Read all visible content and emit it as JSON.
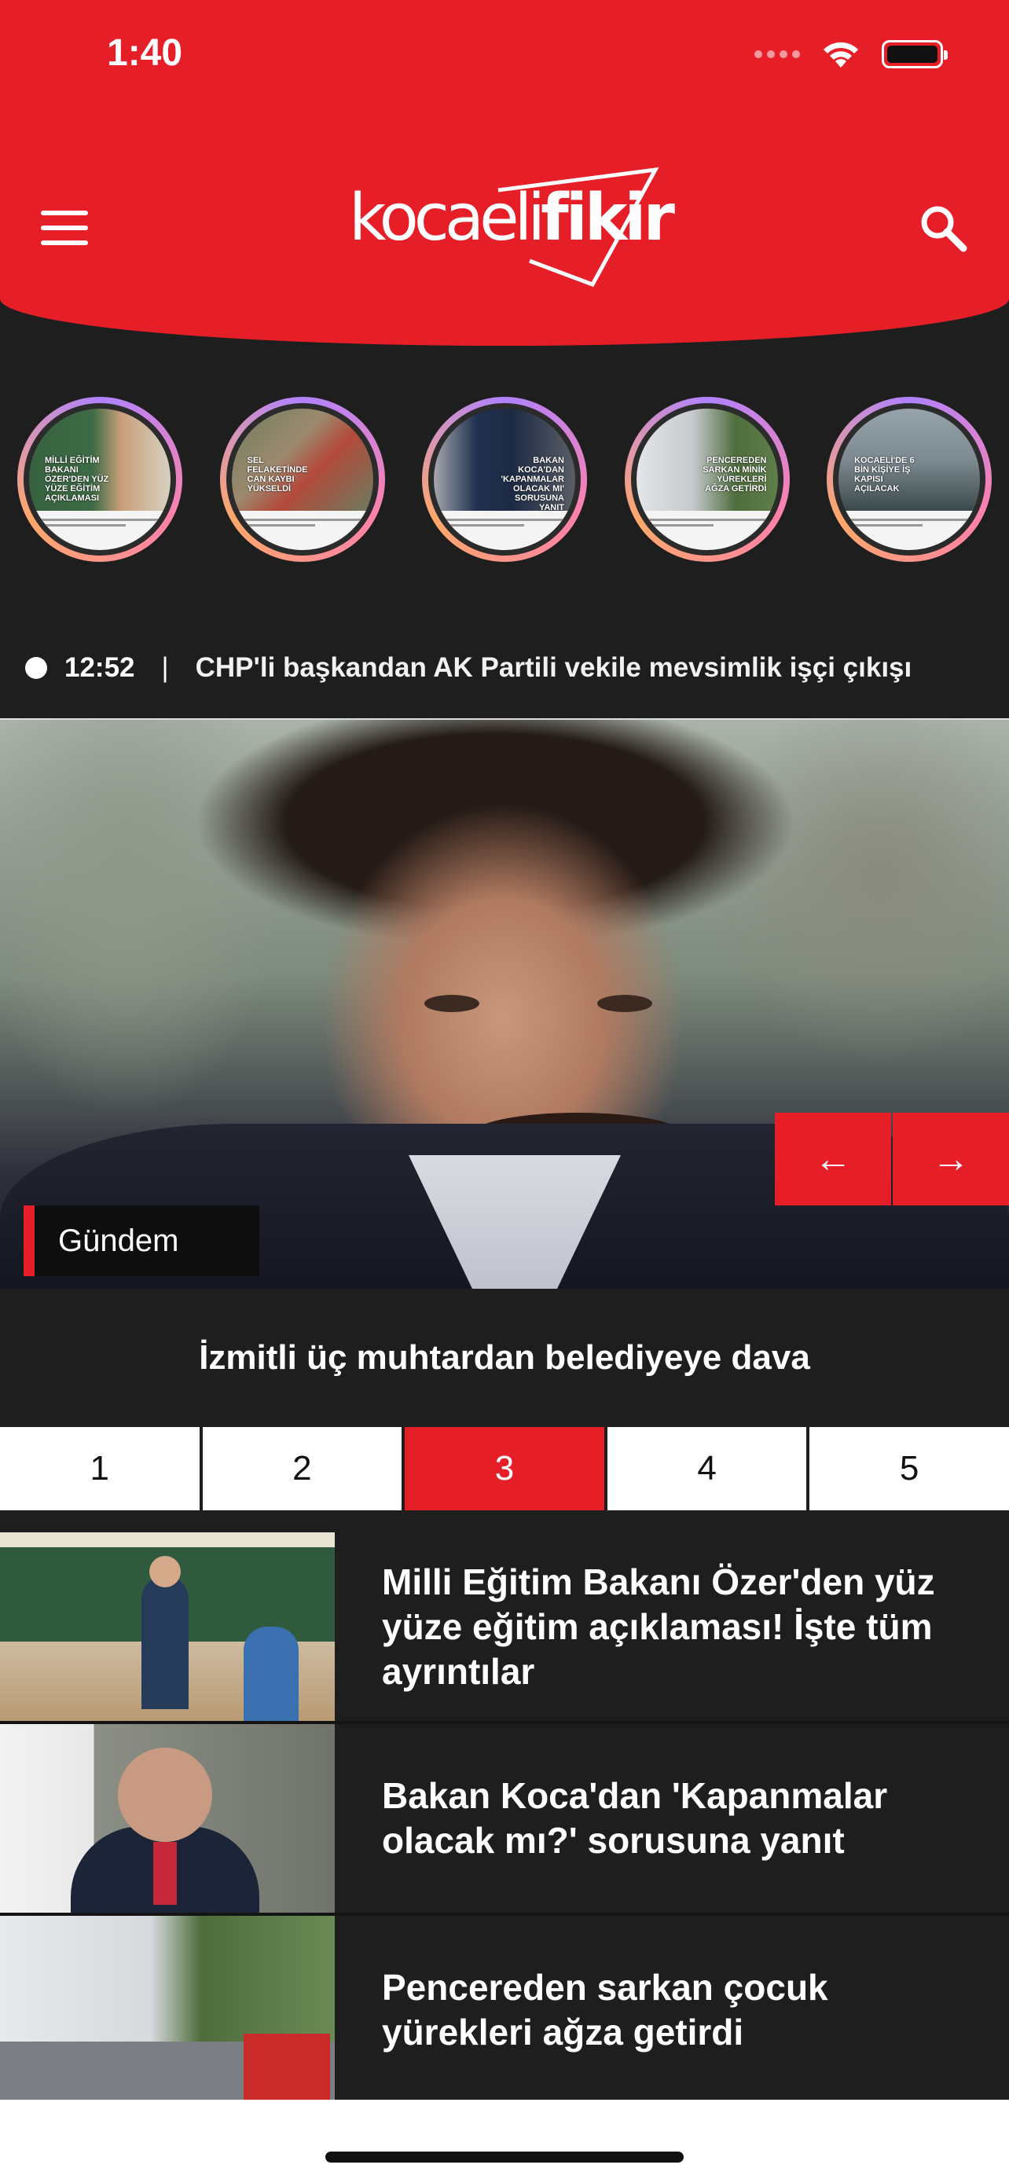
{
  "status_bar": {
    "time": "1:40"
  },
  "header": {
    "logo_left": "kocaeli",
    "logo_right": "fikir"
  },
  "stories": [
    {
      "caption": "MİLLİ EĞİTİM BAKANI ÖZER'DEN YÜZ YÜZE EĞİTİM AÇIKLAMASI"
    },
    {
      "caption": "SEL FELAKETİNDE CAN KAYBI YÜKSELDİ"
    },
    {
      "caption": "BAKAN KOCA'DAN 'KAPANMALAR OLACAK MI' SORUSUNA YANIT"
    },
    {
      "caption": "PENCEREDEN SARKAN MİNİK YÜREKLERİ AĞZA GETİRDİ"
    },
    {
      "caption": "KOCAELİ'DE 6 BİN KİŞİYE İŞ KAPISI AÇILACAK"
    }
  ],
  "ticker": {
    "time": "12:52",
    "separator": "|",
    "headline": "CHP'li başkandan AK Partili vekile mevsimlik işçi çıkışı"
  },
  "hero": {
    "category": "Gündem",
    "title": "İzmitli üç muhtardan belediyeye dava",
    "prev_label": "←",
    "next_label": "→"
  },
  "pager": {
    "pages": [
      "1",
      "2",
      "3",
      "4",
      "5"
    ],
    "active_page": "3"
  },
  "news": [
    {
      "title": "Milli Eğitim Bakanı Özer'den yüz yüze eğitim açıklaması! İşte tüm ayrıntılar"
    },
    {
      "title": "Bakan Koca'dan 'Kapanmalar olacak mı?' sorusuna yanıt"
    },
    {
      "title": "Pencereden sarkan çocuk yürekleri ağza getirdi"
    }
  ],
  "colors": {
    "brand_red": "#e61e28",
    "background": "#1e1e1e"
  }
}
